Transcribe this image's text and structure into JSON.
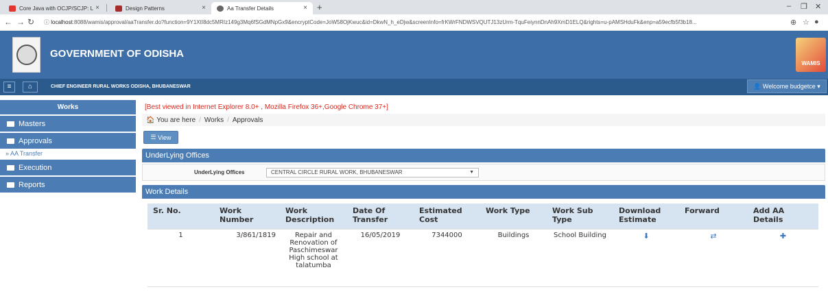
{
  "browser": {
    "tabs": [
      {
        "title": "Core Java with OCJP/SCJP: L"
      },
      {
        "title": "Design Patterns"
      },
      {
        "title": "Aa Transfer Details"
      }
    ],
    "url_host": "localhost",
    "url_rest": ":8088/wamis/approval/aaTransfer.do?function=9Y1XtI8dc5MRIz149g3Mq6fSGdMNpGx9&encryptCode=JoW58OjKwuc&id=DkwN_h_eDjw&screenInfo=frKWrFNDWSVQUTJ13zUrm-TquFeiynnDnAh9XmD1ELQ&rights=u-pAMSHduFk&enp=a59ecfb5f3b18..."
  },
  "header": {
    "title": "GOVERNMENT OF ODISHA",
    "logo_text": "WAMIS"
  },
  "subnav": {
    "office": "CHIEF ENGINEER RURAL WORKS ODISHA, BHUBANESWAR",
    "welcome": "Welcome budgetce"
  },
  "sidebar": {
    "heading": "Works",
    "items": [
      {
        "label": "Masters"
      },
      {
        "label": "Approvals"
      },
      {
        "label": "Execution"
      },
      {
        "label": "Reports"
      }
    ],
    "subitem": "» AA Transfer"
  },
  "main": {
    "notice": "[Best viewed in Internet Explorer 8.0+ , Mozilla Firefox 36+,Google Chrome 37+]",
    "breadcrumb": {
      "lead": "You are here",
      "items": [
        "Works",
        "Approvals"
      ]
    },
    "view_button": "View",
    "panel1_title": "UnderLying Offices",
    "filter_label": "UnderLying Offices",
    "filter_value": "CENTRAL CIRCLE RURAL WORK, BHUBANESWAR",
    "panel2_title": "Work Details",
    "table": {
      "headers": [
        "Sr. No.",
        "Work Number",
        "Work Description",
        "Date Of Transfer",
        "Estimated Cost",
        "Work Type",
        "Work Sub Type",
        "Download Estimate",
        "Forward",
        "Add AA Details"
      ],
      "rows": [
        {
          "sr": "1",
          "work_number": "3/861/1819",
          "description": "Repair and Renovation of Paschimeswar High school at talatumba",
          "date": "16/05/2019",
          "cost": "7344000",
          "type": "Buildings",
          "subtype": "School Building"
        }
      ]
    }
  }
}
